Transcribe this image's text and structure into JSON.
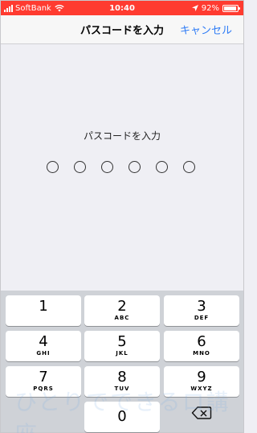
{
  "status_bar": {
    "carrier": "SoftBank",
    "time": "10:40",
    "battery_percent": "92%",
    "battery_level": 0.92
  },
  "nav": {
    "title": "パスコードを入力",
    "cancel": "キャンセル"
  },
  "prompt": "パスコードを入力",
  "passcode_length": 6,
  "keypad": {
    "keys": [
      {
        "digit": "1",
        "letters": ""
      },
      {
        "digit": "2",
        "letters": "ABC"
      },
      {
        "digit": "3",
        "letters": "DEF"
      },
      {
        "digit": "4",
        "letters": "GHI"
      },
      {
        "digit": "5",
        "letters": "JKL"
      },
      {
        "digit": "6",
        "letters": "MNO"
      },
      {
        "digit": "7",
        "letters": "PQRS"
      },
      {
        "digit": "8",
        "letters": "TUV"
      },
      {
        "digit": "9",
        "letters": "WXYZ"
      },
      {
        "digit": "0",
        "letters": ""
      }
    ]
  },
  "watermark": "ひとりでできるロ講座",
  "colors": {
    "status_bar": "#ff3b30",
    "accent": "#2e7cf6",
    "background": "#efeff4",
    "keypad_bg": "#cfd2d7"
  }
}
